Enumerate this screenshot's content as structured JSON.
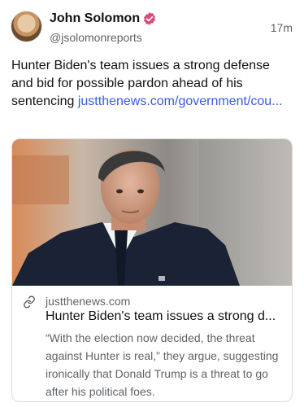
{
  "post": {
    "author": {
      "display_name": "John Solomon",
      "handle": "@jsolomonreports",
      "verified": true,
      "verified_color": "#e0457b"
    },
    "timestamp": "17m",
    "text": "Hunter Biden's team issues a strong defense and bid for possible pardon ahead of his sentencing",
    "link_display": "justthenews.com/government/cou...",
    "link_color": "#3b5bdb"
  },
  "link_card": {
    "domain": "justthenews.com",
    "title": "Hunter Biden's team issues a strong d...",
    "description": "“With the election now decided, the threat against Hunter is real,” they argue, suggesting ironically that Donald Trump is a threat to go after his political foes.",
    "icon": "link-icon"
  }
}
